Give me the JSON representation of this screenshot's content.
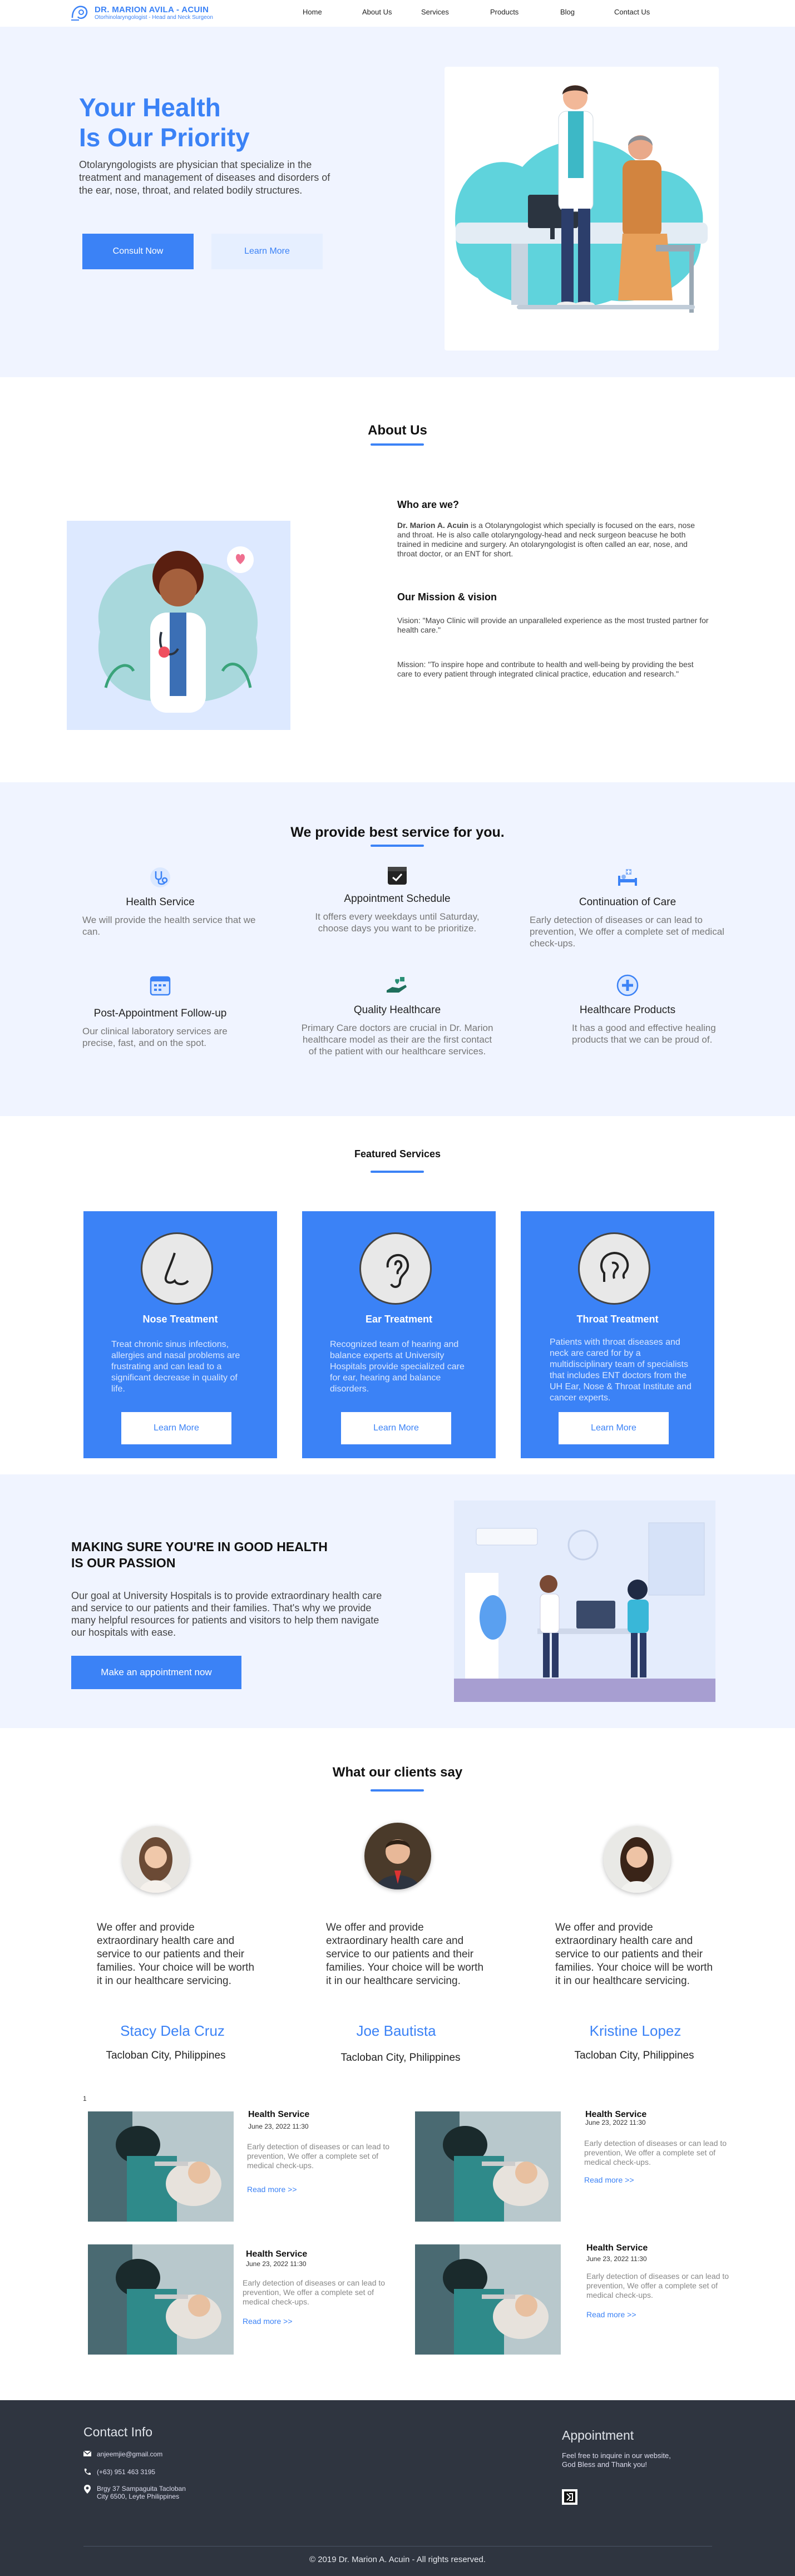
{
  "header": {
    "logo_name": "DR. MARION AVILA - ACUIN",
    "logo_sub": "Otorhinolaryngologist - Head and Neck Surgeon",
    "nav": [
      "Home",
      "About Us",
      "Services",
      "Products",
      "Blog",
      "Contact Us"
    ]
  },
  "hero": {
    "title_line1": "Your Health",
    "title_line2": "Is Our Priority",
    "text": "Otolaryngologists are physician that specialize in the treatment and management of diseases and disorders of the ear, nose, throat, and related bodily structures.",
    "consult_label": "Consult Now",
    "learn_label": "Learn More"
  },
  "about": {
    "title": "About Us",
    "who_heading": "Who are we?",
    "who_name": "Dr. Marion A. Acuin",
    "who_text": " is a Otolaryngologist which specially is focused on the ears, nose and throat. He is also calle otolaryngology-head and neck surgeon beacuse he both trained in medicine and surgery. An otolaryngologist is often called an ear, nose, and throat doctor, or an ENT for short.",
    "mission_heading": "Our Mission & vision",
    "vision_text": "Vision: \"Mayo Clinic will provide an unparalleled experience as the most trusted partner for health care.\"",
    "mission_text": "Mission: \"To inspire hope and contribute to health and well-being by providing the best care to every patient through integrated clinical practice, education and research.\""
  },
  "services": {
    "title": "We provide best service for you.",
    "items": [
      {
        "icon": "stethoscope-icon",
        "title": "Health Service",
        "desc": "We will provide the health service that we can."
      },
      {
        "icon": "calendar-check-icon",
        "title": "Appointment Schedule",
        "desc": "It offers every weekdays until Saturday, choose days you want to be prioritize."
      },
      {
        "icon": "hospital-bed-icon",
        "title": "Continuation of Care",
        "desc": "Early detection of diseases or can lead to prevention, We offer a complete set of medical check-ups."
      },
      {
        "icon": "calendar-icon",
        "title": "Post-Appointment Follow-up",
        "desc": "Our clinical laboratory services are precise, fast, and on the spot."
      },
      {
        "icon": "hand-heart-icon",
        "title": "Quality Healthcare",
        "desc": "Primary Care doctors are crucial in Dr. Marion healthcare model as their are the first contact of the patient with our healthcare services."
      },
      {
        "icon": "medical-cross-icon",
        "title": "Healthcare Products",
        "desc": "It has a good and effective healing products that we can be proud of."
      }
    ]
  },
  "featured": {
    "title": "Featured Services",
    "cards": [
      {
        "icon": "nose-icon",
        "title": "Nose Treatment",
        "text": "Treat chronic sinus infections, allergies and nasal problems are frustrating and can lead to a significant decrease in quality of life.",
        "button": "Learn More"
      },
      {
        "icon": "ear-icon",
        "title": "Ear Treatment",
        "text": "Recognized team of hearing and balance experts at University Hospitals provide specialized care for ear, hearing and balance disorders.",
        "button": "Learn More"
      },
      {
        "icon": "throat-icon",
        "title": "Throat Treatment",
        "text": "Patients with throat diseases and neck are cared for by a multidisciplinary team of specialists that includes ENT doctors from the UH Ear, Nose & Throat Institute and cancer experts.",
        "button": "Learn More"
      }
    ]
  },
  "passion": {
    "title_line1": "MAKING SURE YOU'RE IN  GOOD HEALTH",
    "title_line2": "IS OUR PASSION",
    "text": "Our goal at University Hospitals is to provide extraordinary health care and service to our patients and their families. That's why we provide many helpful resources for patients and visitors to help them navigate our hospitals with ease.",
    "button": "Make an appointment now"
  },
  "testimonials": {
    "title": "What our clients say",
    "items": [
      {
        "text": "We offer and provide extraordinary health care and service to our patients and their families. Your choice will be worth it in our healthcare servicing.",
        "name": "Stacy Dela Cruz",
        "location": "Tacloban City, Philippines"
      },
      {
        "text": "We offer and provide extraordinary health care and service to our patients and their families. Your choice will be worth it in our healthcare servicing.",
        "name": "Joe Bautista",
        "location": "Tacloban City, Philippines"
      },
      {
        "text": "We offer and provide extraordinary health care and service to our patients and their families. Your choice will be worth it in our healthcare servicing.",
        "name": "Kristine Lopez",
        "location": "Tacloban City, Philippines"
      }
    ]
  },
  "blog": {
    "marker": "1",
    "posts": [
      {
        "title": "Health Service",
        "date": "June 23, 2022 11:30",
        "desc": "Early detection of diseases or can lead to prevention, We offer a complete set of medical check-ups.",
        "more": "Read more >>"
      },
      {
        "title": "Health Service",
        "date": "June 23, 2022 11:30",
        "desc": "Early detection of diseases or can lead to prevention, We offer a complete set of medical check-ups.",
        "more": "Read more >>"
      },
      {
        "title": "Health Service",
        "date": "June 23, 2022 11:30",
        "desc": "Early detection of diseases or can lead to prevention, We offer a complete set of medical check-ups.",
        "more": "Read more >>"
      },
      {
        "title": "Health Service",
        "date": "June 23, 2022 11:30",
        "desc": "Early detection of diseases or can lead to prevention, We offer a complete set of medical check-ups.",
        "more": "Read more >>"
      }
    ]
  },
  "footer": {
    "contact_title": "Contact Info",
    "email": "anjeemjie@gmail.com",
    "phone": "(+63) 951 463 3195",
    "address_line1": "Brgy 37 Sampaguita Tacloban",
    "address_line2": "City 6500, Leyte Philippines",
    "appointment_title": "Appointment",
    "appointment_text1": "Feel free to inquire in our website,",
    "appointment_text2": "God Bless and Thank you!",
    "copyright": "© 2019 Dr. Marion A. Acuin - All rights reserved."
  },
  "colors": {
    "accent": "#3b82f6",
    "section_bg": "#f0f4ff",
    "footer_bg": "#2f3540"
  }
}
